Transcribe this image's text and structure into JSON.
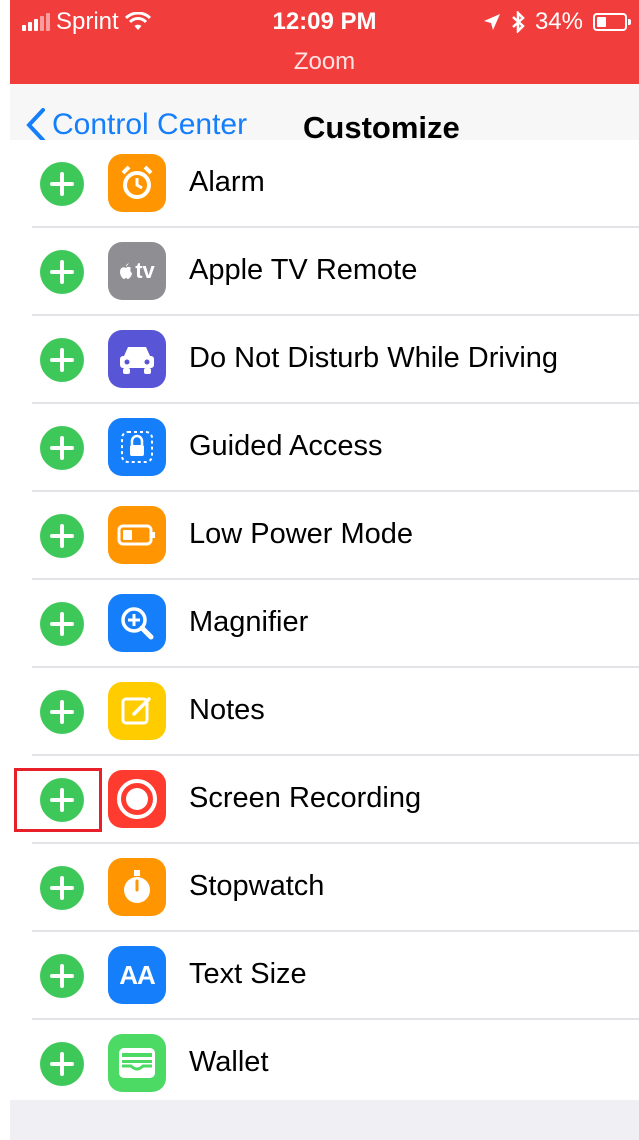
{
  "status_bar": {
    "carrier": "Sprint",
    "time": "12:09 PM",
    "battery_percent": "34%",
    "battery_level": 0.34,
    "zoom_label": "Zoom",
    "background_color": "#f23d3d"
  },
  "nav": {
    "back_label": "Control Center",
    "title": "Customize"
  },
  "controls": [
    {
      "label": "Alarm",
      "icon": "alarm-icon",
      "color": "#ff9500"
    },
    {
      "label": "Apple TV Remote",
      "icon": "apple-tv-icon",
      "icon_text": "tv",
      "color": "#8e8e93"
    },
    {
      "label": "Do Not Disturb While Driving",
      "icon": "car-icon",
      "color": "#5856d6"
    },
    {
      "label": "Guided Access",
      "icon": "lock-icon",
      "color": "#157efb"
    },
    {
      "label": "Low Power Mode",
      "icon": "battery-icon",
      "color": "#ff9500"
    },
    {
      "label": "Magnifier",
      "icon": "magnifier-icon",
      "color": "#157efb"
    },
    {
      "label": "Notes",
      "icon": "notes-icon",
      "color": "#ffcc00"
    },
    {
      "label": "Screen Recording",
      "icon": "record-icon",
      "color": "#ff3b30",
      "highlighted": true
    },
    {
      "label": "Stopwatch",
      "icon": "stopwatch-icon",
      "color": "#ff9500"
    },
    {
      "label": "Text Size",
      "icon": "text-size-icon",
      "icon_text": "AA",
      "color": "#157efb"
    },
    {
      "label": "Wallet",
      "icon": "wallet-icon",
      "color": "#4cd964"
    }
  ],
  "accent_color": "#157efb",
  "add_button_color": "#3ec85a"
}
